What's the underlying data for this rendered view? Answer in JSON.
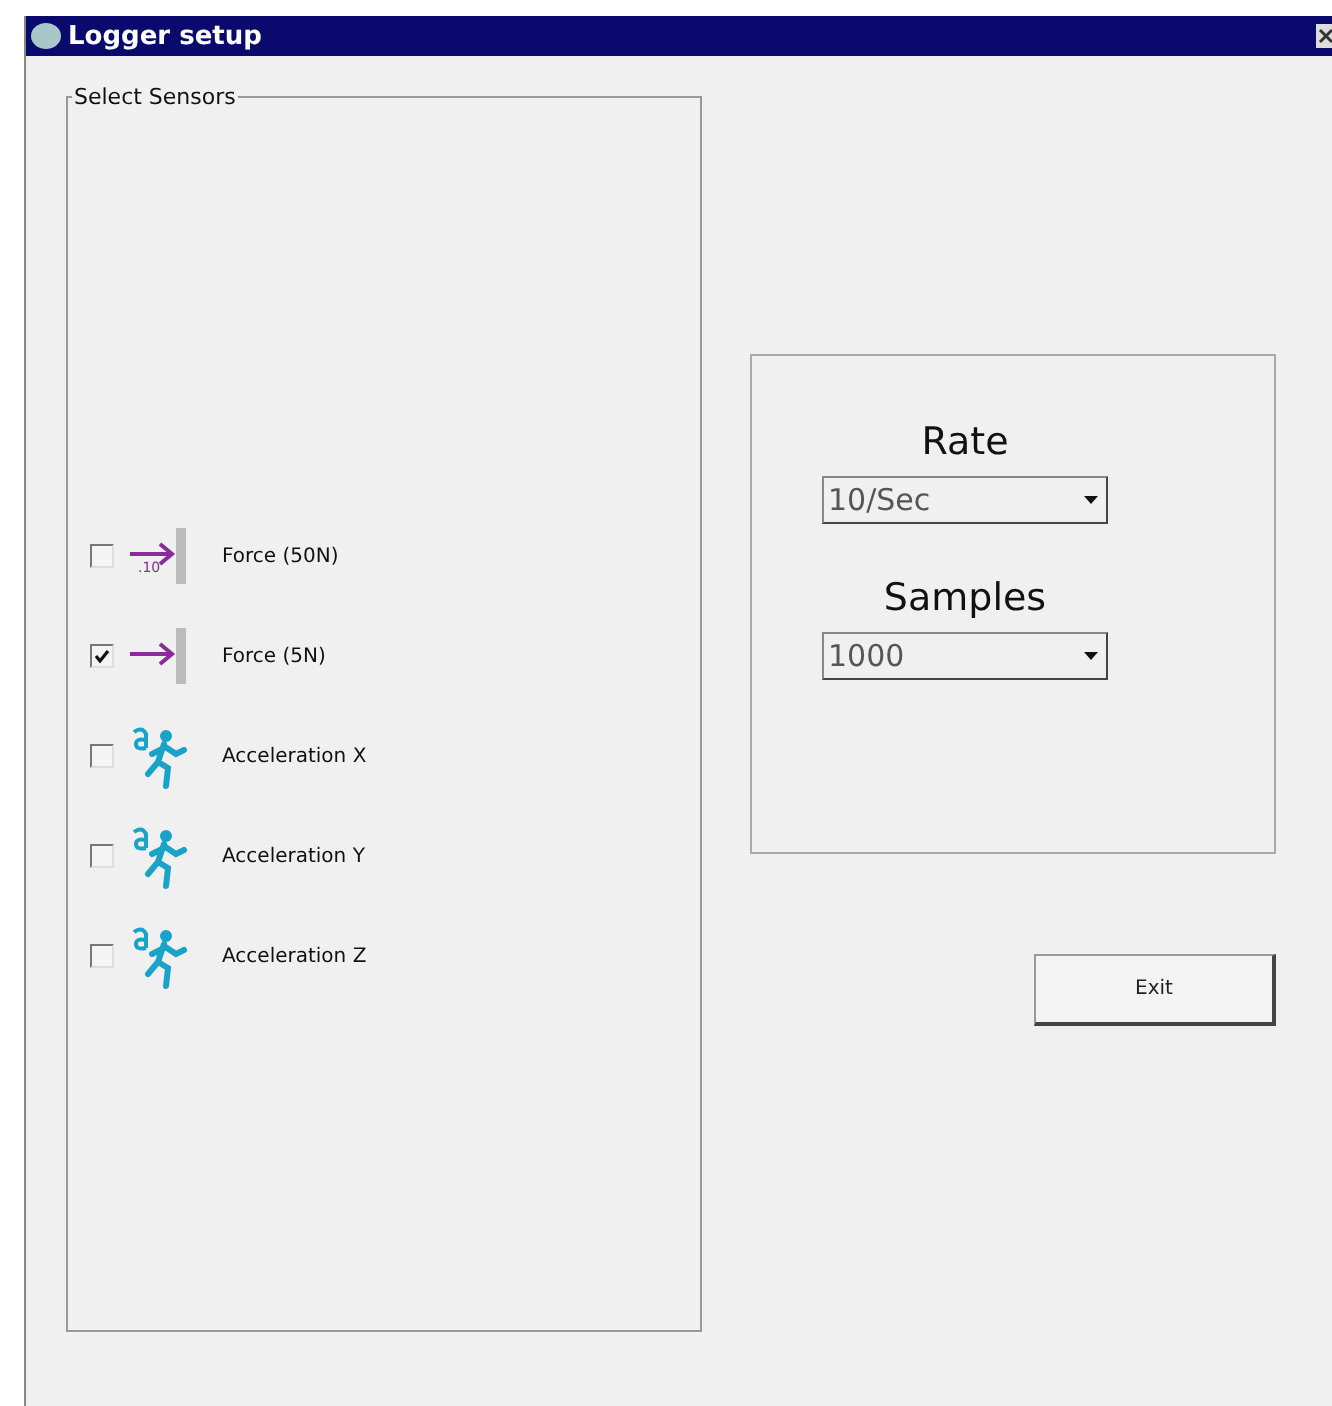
{
  "window": {
    "title": "Logger setup"
  },
  "sensors_group": {
    "title": "Select Sensors",
    "sensors": [
      {
        "label": "Force (50N)",
        "kind": "force",
        "icon_text": ".10",
        "checked": false
      },
      {
        "label": "Force (5N)",
        "kind": "force",
        "checked": true
      },
      {
        "label": "Acceleration X",
        "kind": "acceleration",
        "checked": false
      },
      {
        "label": "Acceleration Y",
        "kind": "acceleration",
        "checked": false
      },
      {
        "label": "Acceleration Z",
        "kind": "acceleration",
        "checked": false
      }
    ]
  },
  "settings": [
    {
      "label": "Rate",
      "value": "10/Sec"
    },
    {
      "label": "Samples",
      "value": "1000"
    }
  ],
  "buttons": [
    {
      "label": "Exit"
    }
  ]
}
